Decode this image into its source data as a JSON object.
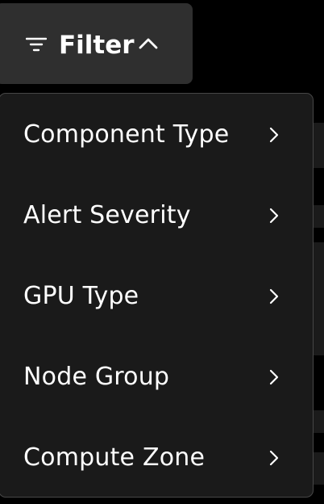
{
  "filter_button": {
    "label": "Filter",
    "icon": "filter-lines-icon",
    "state_icon": "chevron-up-icon"
  },
  "menu": {
    "items": [
      {
        "label": "Component Type",
        "icon": "chevron-right-icon"
      },
      {
        "label": "Alert Severity",
        "icon": "chevron-right-icon"
      },
      {
        "label": "GPU Type",
        "icon": "chevron-right-icon"
      },
      {
        "label": "Node Group",
        "icon": "chevron-right-icon"
      },
      {
        "label": "Compute Zone",
        "icon": "chevron-right-icon"
      }
    ]
  },
  "colors": {
    "page_background": "#000000",
    "button_background": "#2f2f2f",
    "menu_background": "#1a1a1a",
    "menu_border": "#474747",
    "text": "#ffffff"
  }
}
